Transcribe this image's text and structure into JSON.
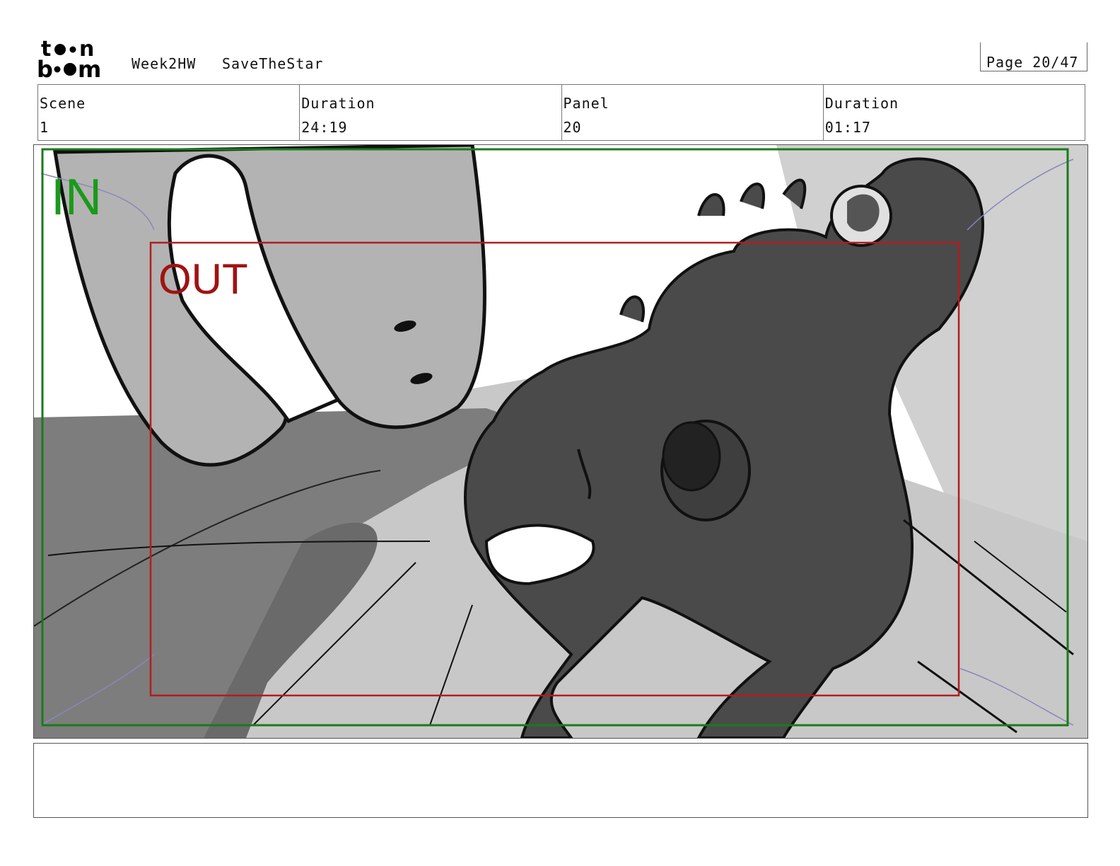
{
  "header": {
    "logo_top": "to•n",
    "logo_bottom": "b••m",
    "project": "Week2HW",
    "scene_name": "SaveTheStar",
    "page": "Page 20/47"
  },
  "info": {
    "scene_label": "Scene",
    "scene_value": "1",
    "duration_label": "Duration",
    "duration_value": "24:19",
    "panel_label": "Panel",
    "panel_value": "20",
    "panel_duration_label": "Duration",
    "panel_duration_value": "01:17"
  },
  "frame": {
    "in_label": "IN",
    "out_label": "OUT",
    "in_color": "#1a9a1a",
    "out_color": "#a11212"
  },
  "notes": {
    "text": ""
  }
}
